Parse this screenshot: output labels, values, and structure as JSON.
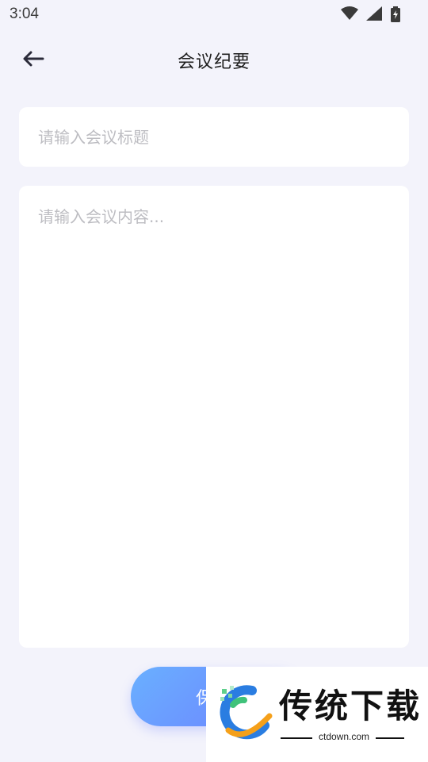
{
  "status_bar": {
    "time": "3:04",
    "icons": [
      "wifi-icon",
      "cellular-signal-icon",
      "battery-charging-icon"
    ]
  },
  "header": {
    "back_icon": "arrow-left-icon",
    "title": "会议纪要"
  },
  "form": {
    "title_placeholder": "请输入会议标题",
    "title_value": "",
    "content_placeholder": "请输入会议内容...",
    "content_value": ""
  },
  "actions": {
    "save_label": "保存"
  },
  "watermark": {
    "brand": "传统下载",
    "url": "ctdown.com"
  },
  "colors": {
    "background": "#f3f3fb",
    "card": "#ffffff",
    "button_gradient_start": "#6ab0ff",
    "button_gradient_end": "#6d7cff",
    "placeholder": "#bdbdc2"
  }
}
